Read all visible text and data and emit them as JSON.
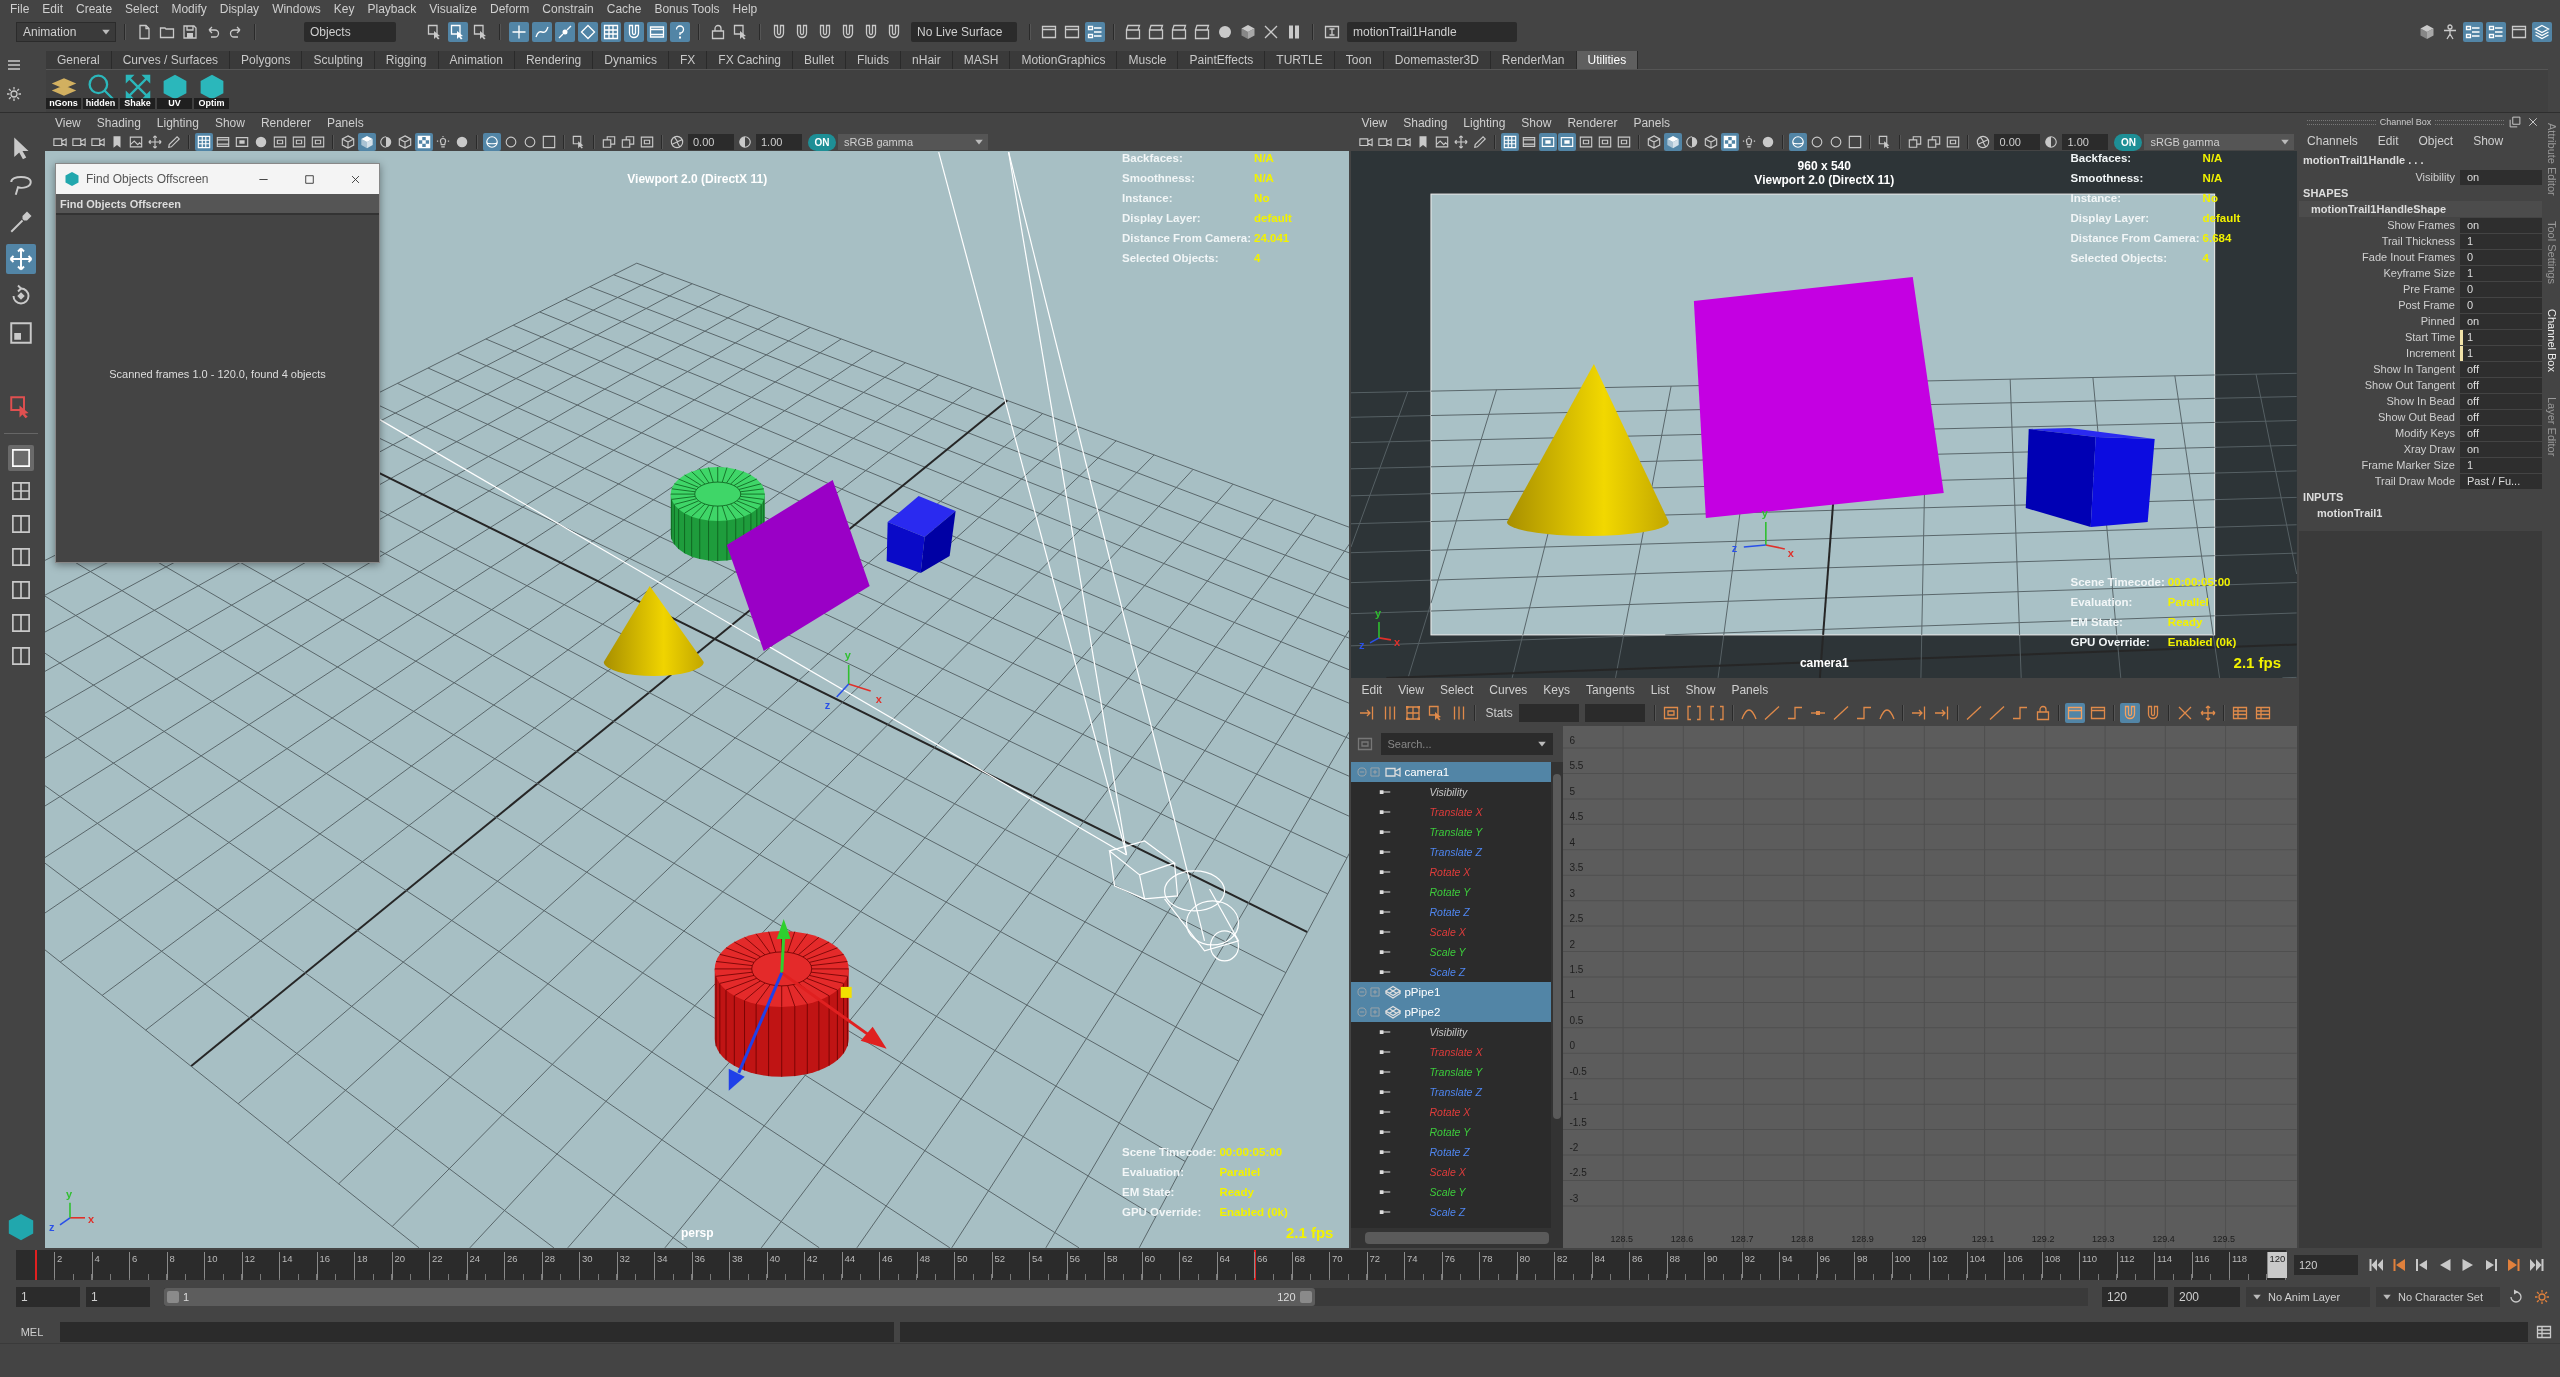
{
  "menu_bar": [
    "File",
    "Edit",
    "Create",
    "Select",
    "Modify",
    "Display",
    "Windows",
    "Key",
    "Playback",
    "Visualize",
    "Deform",
    "Constrain",
    "Cache",
    "Bonus Tools",
    "Help"
  ],
  "status_line": {
    "mode": "Animation",
    "file_tools": [
      {
        "kind": "page",
        "on": false
      },
      {
        "kind": "folder",
        "on": false
      },
      {
        "kind": "disk",
        "on": false
      },
      {
        "kind": "undo",
        "on": false
      },
      {
        "kind": "redo",
        "on": false
      }
    ],
    "selection_mode": "Objects",
    "select_tools": [
      {
        "kind": "selectbox",
        "on": false
      },
      {
        "kind": "selectbox",
        "on": true
      },
      {
        "kind": "selectbox",
        "on": false
      }
    ],
    "snap_tools": [
      {
        "kind": "plus",
        "on": true
      },
      {
        "kind": "curve",
        "on": true
      },
      {
        "kind": "point",
        "on": true
      },
      {
        "kind": "diamond",
        "on": true
      },
      {
        "kind": "grid",
        "on": true
      },
      {
        "kind": "magnet",
        "on": true
      },
      {
        "kind": "film",
        "on": true
      },
      {
        "kind": "question",
        "on": true
      }
    ],
    "lock_tools": [
      {
        "kind": "lock",
        "on": false
      },
      {
        "kind": "selectbox",
        "on": false
      }
    ],
    "history_tools": [
      {
        "kind": "magnet",
        "on": false
      },
      {
        "kind": "magnet",
        "on": false
      },
      {
        "kind": "magnet",
        "on": false
      },
      {
        "kind": "magnet",
        "on": false
      },
      {
        "kind": "magnet",
        "on": false
      },
      {
        "kind": "magnet",
        "on": false
      }
    ],
    "live_surface": "No Live Surface",
    "io_tools": [
      {
        "kind": "window",
        "on": false
      },
      {
        "kind": "window",
        "on": false
      },
      {
        "kind": "list",
        "on": true
      }
    ],
    "render_tools": [
      {
        "kind": "clapper",
        "on": false
      },
      {
        "kind": "clapper",
        "on": false
      },
      {
        "kind": "clapper",
        "on": false
      },
      {
        "kind": "clapper",
        "on": false
      },
      {
        "kind": "disc",
        "on": false
      },
      {
        "kind": "cube",
        "on": false
      },
      {
        "kind": "cross",
        "on": false
      },
      {
        "kind": "pause",
        "on": false
      }
    ],
    "name_field": "motionTrail1Handle",
    "panel_tools": [
      {
        "kind": "cube",
        "on": false
      },
      {
        "kind": "person",
        "on": false
      },
      {
        "kind": "list",
        "on": true
      },
      {
        "kind": "list",
        "on": true
      },
      {
        "kind": "window",
        "on": false
      },
      {
        "kind": "layers",
        "on": true
      }
    ]
  },
  "shelf": {
    "tabs": [
      {
        "label": "General",
        "selected": false
      },
      {
        "label": "Curves / Surfaces",
        "selected": false
      },
      {
        "label": "Polygons",
        "selected": false
      },
      {
        "label": "Sculpting",
        "selected": false
      },
      {
        "label": "Rigging",
        "selected": false
      },
      {
        "label": "Animation",
        "selected": false
      },
      {
        "label": "Rendering",
        "selected": false
      },
      {
        "label": "Dynamics",
        "selected": false
      },
      {
        "label": "FX",
        "selected": false
      },
      {
        "label": "FX Caching",
        "selected": false
      },
      {
        "label": "Bullet",
        "selected": false
      },
      {
        "label": "Fluids",
        "selected": false
      },
      {
        "label": "nHair",
        "selected": false
      },
      {
        "label": "MASH",
        "selected": false
      },
      {
        "label": "MotionGraphics",
        "selected": false
      },
      {
        "label": "Muscle",
        "selected": false
      },
      {
        "label": "PaintEffects",
        "selected": false
      },
      {
        "label": "TURTLE",
        "selected": false
      },
      {
        "label": "Toon",
        "selected": false
      },
      {
        "label": "Domemaster3D",
        "selected": false
      },
      {
        "label": "RenderMan",
        "selected": false
      },
      {
        "label": "Utilities",
        "selected": true
      }
    ],
    "buttons": [
      {
        "kind": "tiles",
        "label": "nGons"
      },
      {
        "kind": "magnifier",
        "label": "hidden"
      },
      {
        "kind": "arrows",
        "label": "Shake"
      },
      {
        "kind": "hexagon",
        "label": "UV"
      },
      {
        "kind": "hexagon",
        "label": "Optim"
      }
    ]
  },
  "toolbox": {
    "tools": [
      {
        "kind": "cursor",
        "on": false
      },
      {
        "kind": "lasso",
        "on": false
      },
      {
        "kind": "brush",
        "on": false
      },
      {
        "kind": "move",
        "on": true
      },
      {
        "kind": "rotate",
        "on": false
      },
      {
        "kind": "scale",
        "on": false
      }
    ],
    "last_tool": [
      {
        "kind": "selectbox",
        "on": false
      }
    ],
    "layouts": [
      {
        "kind": "pane",
        "on": true
      },
      {
        "kind": "quad",
        "on": false
      },
      {
        "kind": "panes",
        "on": false
      },
      {
        "kind": "panes",
        "on": false
      },
      {
        "kind": "panes",
        "on": false
      },
      {
        "kind": "panes",
        "on": false
      },
      {
        "kind": "panes",
        "on": false
      }
    ]
  },
  "panels": [
    {
      "kind": "overview",
      "menus": [
        "View",
        "Shading",
        "Lighting",
        "Show",
        "Renderer",
        "Panels"
      ],
      "toolbar": {
        "groups": [
          [
            {
              "kind": "camera",
              "on": false
            },
            {
              "kind": "camera",
              "on": false
            },
            {
              "kind": "camera",
              "on": false
            },
            {
              "kind": "bookmark",
              "on": false
            },
            {
              "kind": "image",
              "on": false
            },
            {
              "kind": "move",
              "on": false
            },
            {
              "kind": "pencil",
              "on": false
            }
          ],
          [
            {
              "kind": "grid",
              "on": true
            },
            {
              "kind": "film",
              "on": false
            },
            {
              "kind": "gate",
              "on": false
            },
            {
              "kind": "disc",
              "on": false
            },
            {
              "kind": "frame",
              "on": false
            },
            {
              "kind": "frame",
              "on": false
            },
            {
              "kind": "frame",
              "on": false
            }
          ],
          [
            {
              "kind": "wirecube",
              "on": false
            },
            {
              "kind": "cube",
              "on": true
            },
            {
              "kind": "halfdisc",
              "on": false
            },
            {
              "kind": "wirecube",
              "on": false
            },
            {
              "kind": "checker",
              "on": true
            },
            {
              "kind": "bulb",
              "on": false
            },
            {
              "kind": "disc",
              "on": false
            }
          ],
          [
            {
              "kind": "sphere",
              "on": true
            },
            {
              "kind": "ring",
              "on": false
            },
            {
              "kind": "ring",
              "on": false
            },
            {
              "kind": "pane",
              "on": false
            }
          ],
          [
            {
              "kind": "selectbox",
              "on": false
            }
          ],
          [
            {
              "kind": "copies",
              "on": false
            },
            {
              "kind": "copies",
              "on": false
            },
            {
              "kind": "frame",
              "on": false
            }
          ]
        ],
        "exposure": "0.00",
        "gamma": "1.00",
        "color_management": {
          "label": "ON",
          "on": true
        },
        "view_transform": "sRGB gamma"
      },
      "title": "Viewport 2.0 (DirectX 11)",
      "hud_top": [
        {
          "label": "Backfaces:",
          "value": "N/A"
        },
        {
          "label": "Smoothness:",
          "value": "N/A"
        },
        {
          "label": "Instance:",
          "value": "No"
        },
        {
          "label": "Display Layer:",
          "value": "default"
        },
        {
          "label": "Distance From Camera:",
          "value": "24.041"
        },
        {
          "label": "Selected Objects:",
          "value": "4"
        }
      ],
      "hud_bottom": [
        {
          "label": "Scene Timecode:",
          "value": "00:00:05:00"
        },
        {
          "label": "Evaluation:",
          "value": "Parallel"
        },
        {
          "label": "EM State:",
          "value": "Ready"
        },
        {
          "label": "GPU Override:",
          "value": "Enabled (0k)"
        }
      ],
      "camera": "persp",
      "fps": "2.1 fps",
      "origin_axis": [
        "x",
        "y",
        "z"
      ],
      "view_axis": [
        "x",
        "y",
        "z"
      ]
    },
    {
      "kind": "camera",
      "menus": [
        "View",
        "Shading",
        "Lighting",
        "Show",
        "Renderer",
        "Panels"
      ],
      "toolbar": {
        "groups": [
          [
            {
              "kind": "camera",
              "on": false
            },
            {
              "kind": "camera",
              "on": false
            },
            {
              "kind": "camera",
              "on": false
            },
            {
              "kind": "bookmark",
              "on": false
            },
            {
              "kind": "image",
              "on": false
            },
            {
              "kind": "move",
              "on": false
            },
            {
              "kind": "pencil",
              "on": false
            }
          ],
          [
            {
              "kind": "grid",
              "on": true
            },
            {
              "kind": "film",
              "on": false
            },
            {
              "kind": "gate",
              "on": true
            },
            {
              "kind": "gate",
              "on": true
            },
            {
              "kind": "frame",
              "on": false
            },
            {
              "kind": "frame",
              "on": false
            },
            {
              "kind": "frame",
              "on": false
            }
          ],
          [
            {
              "kind": "wirecube",
              "on": false
            },
            {
              "kind": "cube",
              "on": true
            },
            {
              "kind": "halfdisc",
              "on": false
            },
            {
              "kind": "wirecube",
              "on": false
            },
            {
              "kind": "checker",
              "on": true
            },
            {
              "kind": "bulb",
              "on": false
            },
            {
              "kind": "disc",
              "on": false
            }
          ],
          [
            {
              "kind": "sphere",
              "on": true
            },
            {
              "kind": "ring",
              "on": false
            },
            {
              "kind": "ring",
              "on": false
            },
            {
              "kind": "pane",
              "on": false
            }
          ],
          [
            {
              "kind": "selectbox",
              "on": false
            }
          ],
          [
            {
              "kind": "copies",
              "on": false
            },
            {
              "kind": "copies",
              "on": false
            },
            {
              "kind": "frame",
              "on": false
            }
          ]
        ],
        "exposure": "0.00",
        "gamma": "1.00",
        "color_management": {
          "label": "ON",
          "on": true
        },
        "view_transform": "sRGB gamma"
      },
      "resolution": "960 x 540",
      "title": "Viewport 2.0 (DirectX 11)",
      "hud_top": [
        {
          "label": "Backfaces:",
          "value": "N/A"
        },
        {
          "label": "Smoothness:",
          "value": "N/A"
        },
        {
          "label": "Instance:",
          "value": "No"
        },
        {
          "label": "Display Layer:",
          "value": "default"
        },
        {
          "label": "Distance From Camera:",
          "value": "6.684"
        },
        {
          "label": "Selected Objects:",
          "value": "4"
        }
      ],
      "hud_bottom": [
        {
          "label": "Scene Timecode:",
          "value": "00:00:05:00"
        },
        {
          "label": "Evaluation:",
          "value": "Parallel"
        },
        {
          "label": "EM State:",
          "value": "Ready"
        },
        {
          "label": "GPU Override:",
          "value": "Enabled (0k)"
        }
      ],
      "camera": "camera1",
      "fps": "2.1 fps",
      "origin_axis": [
        "x",
        "y",
        "z"
      ],
      "view_axis": [
        "x",
        "y",
        "z"
      ]
    }
  ],
  "find_window": {
    "title": "Find Objects Offscreen",
    "header": "Find Objects Offscreen",
    "message": "Scanned frames 1.0 - 120.0, found 4 objects"
  },
  "graph_editor": {
    "menus": [
      "Edit",
      "View",
      "Select",
      "Curves",
      "Keys",
      "Tangents",
      "List",
      "Show",
      "Panels"
    ],
    "tools_left": [
      {
        "kind": "keymove",
        "on": false
      },
      {
        "kind": "bars",
        "on": false
      },
      {
        "kind": "lattice",
        "on": false
      },
      {
        "kind": "selectbox",
        "on": false
      },
      {
        "kind": "bars",
        "on": false
      }
    ],
    "stats_label": "Stats",
    "tools_right": [
      [
        {
          "kind": "frame",
          "on": false
        },
        {
          "kind": "brackets",
          "on": false
        },
        {
          "kind": "brackets",
          "on": false
        }
      ],
      [
        {
          "kind": "spline",
          "on": false
        },
        {
          "kind": "line",
          "on": false
        },
        {
          "kind": "step",
          "on": false
        },
        {
          "kind": "flat",
          "on": false
        },
        {
          "kind": "line",
          "on": false
        },
        {
          "kind": "step",
          "on": false
        },
        {
          "kind": "spline",
          "on": false
        }
      ],
      [
        {
          "kind": "keymove",
          "on": false
        },
        {
          "kind": "keymove",
          "on": false
        }
      ],
      [
        {
          "kind": "line",
          "on": false
        },
        {
          "kind": "line",
          "on": false
        },
        {
          "kind": "step",
          "on": false
        },
        {
          "kind": "lock",
          "on": false
        }
      ],
      [
        {
          "kind": "window",
          "on": true
        },
        {
          "kind": "window",
          "on": false
        }
      ],
      [
        {
          "kind": "magnet",
          "on": true
        },
        {
          "kind": "magnet",
          "on": false
        }
      ],
      [
        {
          "kind": "cross",
          "on": false
        },
        {
          "kind": "move",
          "on": false
        }
      ],
      [
        {
          "kind": "table",
          "on": false
        },
        {
          "kind": "table",
          "on": false
        }
      ]
    ],
    "outliner": {
      "search_placeholder": "Search...",
      "items": [
        {
          "kind": "camera",
          "label": "camera1",
          "selected": true,
          "children": [
            {
              "label": "Visibility",
              "color": "#c8c8c8"
            },
            {
              "label": "Translate X",
              "color": "#e03c3c"
            },
            {
              "label": "Translate Y",
              "color": "#3ccc3c"
            },
            {
              "label": "Translate Z",
              "color": "#4f86f0"
            },
            {
              "label": "Rotate X",
              "color": "#e03c3c"
            },
            {
              "label": "Rotate Y",
              "color": "#3ccc3c"
            },
            {
              "label": "Rotate Z",
              "color": "#4f86f0"
            },
            {
              "label": "Scale X",
              "color": "#e03c3c"
            },
            {
              "label": "Scale Y",
              "color": "#3ccc3c"
            },
            {
              "label": "Scale Z",
              "color": "#4f86f0"
            }
          ]
        },
        {
          "kind": "mesh",
          "label": "pPipe1",
          "selected": true
        },
        {
          "kind": "mesh",
          "label": "pPipe2",
          "selected": true,
          "children": [
            {
              "label": "Visibility",
              "color": "#c8c8c8"
            },
            {
              "label": "Translate X",
              "color": "#e03c3c"
            },
            {
              "label": "Translate Y",
              "color": "#3ccc3c"
            },
            {
              "label": "Translate Z",
              "color": "#4f86f0"
            },
            {
              "label": "Rotate X",
              "color": "#e03c3c"
            },
            {
              "label": "Rotate Y",
              "color": "#3ccc3c"
            },
            {
              "label": "Rotate Z",
              "color": "#4f86f0"
            },
            {
              "label": "Scale X",
              "color": "#e03c3c"
            },
            {
              "label": "Scale Y",
              "color": "#3ccc3c"
            },
            {
              "label": "Scale Z",
              "color": "#4f86f0"
            }
          ]
        }
      ]
    },
    "y_ticks": [
      "6",
      "5.5",
      "5",
      "4.5",
      "4",
      "3.5",
      "3",
      "2.5",
      "2",
      "1.5",
      "1",
      "0.5",
      "0",
      "-0.5",
      "-1",
      "-1.5",
      "-2",
      "-2.5",
      "-3"
    ],
    "x_ticks": [
      "128.5",
      "128.6",
      "128.7",
      "128.8",
      "128.9",
      "129",
      "129.1",
      "129.2",
      "129.3",
      "129.4",
      "129.5"
    ]
  },
  "channel_box": {
    "title": "Channel Box",
    "menus": [
      "Channels",
      "Edit",
      "Object",
      "Show"
    ],
    "node": "motionTrail1Handle . . .",
    "node_attributes": [
      {
        "label": "Visibility",
        "value": "on",
        "keyed": false
      }
    ],
    "shapes_heading": "SHAPES",
    "shape": "motionTrail1HandleShape",
    "shape_attributes": [
      {
        "label": "Show Frames",
        "value": "on",
        "keyed": false
      },
      {
        "label": "Trail Thickness",
        "value": "1",
        "keyed": false
      },
      {
        "label": "Fade Inout Frames",
        "value": "0",
        "keyed": false
      },
      {
        "label": "Keyframe Size",
        "value": "1",
        "keyed": false
      },
      {
        "label": "Pre Frame",
        "value": "0",
        "keyed": false
      },
      {
        "label": "Post Frame",
        "value": "0",
        "keyed": false
      },
      {
        "label": "Pinned",
        "value": "on",
        "keyed": false
      },
      {
        "label": "Start Time",
        "value": "1",
        "keyed": true
      },
      {
        "label": "Increment",
        "value": "1",
        "keyed": true
      },
      {
        "label": "Show In Tangent",
        "value": "off",
        "keyed": false
      },
      {
        "label": "Show Out Tangent",
        "value": "off",
        "keyed": false
      },
      {
        "label": "Show In Bead",
        "value": "off",
        "keyed": false
      },
      {
        "label": "Show Out Bead",
        "value": "off",
        "keyed": false
      },
      {
        "label": "Modify Keys",
        "value": "off",
        "keyed": false
      },
      {
        "label": "Xray Draw",
        "value": "on",
        "keyed": false
      },
      {
        "label": "Frame Marker Size",
        "value": "1",
        "keyed": false
      },
      {
        "label": "Trail Draw Mode",
        "value": "Past / Fu...",
        "keyed": false
      }
    ],
    "inputs_heading": "INPUTS",
    "inputs": [
      "motionTrail1"
    ]
  },
  "side_tabs": [
    {
      "label": "Attribute Editor",
      "selected": false
    },
    {
      "label": "Tool Settings",
      "selected": false
    },
    {
      "label": "Channel Box",
      "selected": true
    },
    {
      "label": "Layer Editor",
      "selected": false
    }
  ],
  "time_slider": {
    "first_frame_key": true,
    "ticks": [
      {
        "label": "2",
        "key": false,
        "current": false
      },
      {
        "label": "4",
        "key": false,
        "current": false
      },
      {
        "label": "6",
        "key": false,
        "current": false
      },
      {
        "label": "8",
        "key": false,
        "current": false
      },
      {
        "label": "10",
        "key": false,
        "current": false
      },
      {
        "label": "12",
        "key": false,
        "current": false
      },
      {
        "label": "14",
        "key": false,
        "current": false
      },
      {
        "label": "16",
        "key": false,
        "current": false
      },
      {
        "label": "18",
        "key": false,
        "current": false
      },
      {
        "label": "20",
        "key": false,
        "current": false
      },
      {
        "label": "22",
        "key": false,
        "current": false
      },
      {
        "label": "24",
        "key": false,
        "current": false
      },
      {
        "label": "26",
        "key": false,
        "current": false
      },
      {
        "label": "28",
        "key": false,
        "current": false
      },
      {
        "label": "30",
        "key": false,
        "current": false
      },
      {
        "label": "32",
        "key": false,
        "current": false
      },
      {
        "label": "34",
        "key": false,
        "current": false
      },
      {
        "label": "36",
        "key": false,
        "current": false
      },
      {
        "label": "38",
        "key": false,
        "current": false
      },
      {
        "label": "40",
        "key": false,
        "current": false
      },
      {
        "label": "42",
        "key": false,
        "current": false
      },
      {
        "label": "44",
        "key": false,
        "current": false
      },
      {
        "label": "46",
        "key": false,
        "current": false
      },
      {
        "label": "48",
        "key": false,
        "current": false
      },
      {
        "label": "50",
        "key": false,
        "current": false
      },
      {
        "label": "52",
        "key": false,
        "current": false
      },
      {
        "label": "54",
        "key": false,
        "current": false
      },
      {
        "label": "56",
        "key": false,
        "current": false
      },
      {
        "label": "58",
        "key": false,
        "current": false
      },
      {
        "label": "60",
        "key": false,
        "current": false
      },
      {
        "label": "62",
        "key": false,
        "current": false
      },
      {
        "label": "64",
        "key": false,
        "current": false
      },
      {
        "label": "66",
        "key": true,
        "current": false
      },
      {
        "label": "68",
        "key": false,
        "current": false
      },
      {
        "label": "70",
        "key": false,
        "current": false
      },
      {
        "label": "72",
        "key": false,
        "current": false
      },
      {
        "label": "74",
        "key": false,
        "current": false
      },
      {
        "label": "76",
        "key": false,
        "current": false
      },
      {
        "label": "78",
        "key": false,
        "current": false
      },
      {
        "label": "80",
        "key": false,
        "current": false
      },
      {
        "label": "82",
        "key": false,
        "current": false
      },
      {
        "label": "84",
        "key": false,
        "current": false
      },
      {
        "label": "86",
        "key": false,
        "current": false
      },
      {
        "label": "88",
        "key": false,
        "current": false
      },
      {
        "label": "90",
        "key": false,
        "current": false
      },
      {
        "label": "92",
        "key": false,
        "current": false
      },
      {
        "label": "94",
        "key": false,
        "current": false
      },
      {
        "label": "96",
        "key": false,
        "current": false
      },
      {
        "label": "98",
        "key": false,
        "current": false
      },
      {
        "label": "100",
        "key": false,
        "current": false
      },
      {
        "label": "102",
        "key": false,
        "current": false
      },
      {
        "label": "104",
        "key": false,
        "current": false
      },
      {
        "label": "106",
        "key": false,
        "current": false
      },
      {
        "label": "108",
        "key": false,
        "current": false
      },
      {
        "label": "110",
        "key": false,
        "current": false
      },
      {
        "label": "112",
        "key": false,
        "current": false
      },
      {
        "label": "114",
        "key": false,
        "current": false
      },
      {
        "label": "116",
        "key": false,
        "current": false
      },
      {
        "label": "118",
        "key": false,
        "current": false
      },
      {
        "label": "120",
        "key": false,
        "current": true
      }
    ],
    "current_frame": "120",
    "playback": [
      {
        "kind": "start"
      },
      {
        "kind": "prevkey"
      },
      {
        "kind": "prevframe"
      },
      {
        "kind": "back"
      },
      {
        "kind": "play"
      },
      {
        "kind": "nextframe"
      },
      {
        "kind": "nextkey"
      },
      {
        "kind": "end"
      }
    ]
  },
  "range_slider": {
    "animation_start": "1",
    "playback_start": "1",
    "range_start": "1",
    "range_end": "120",
    "level": 0.598,
    "playback_end": "120",
    "animation_end": "200",
    "anim_layer": "No Anim Layer",
    "character_set": "No Character Set"
  },
  "command_line": {
    "language": "MEL"
  }
}
